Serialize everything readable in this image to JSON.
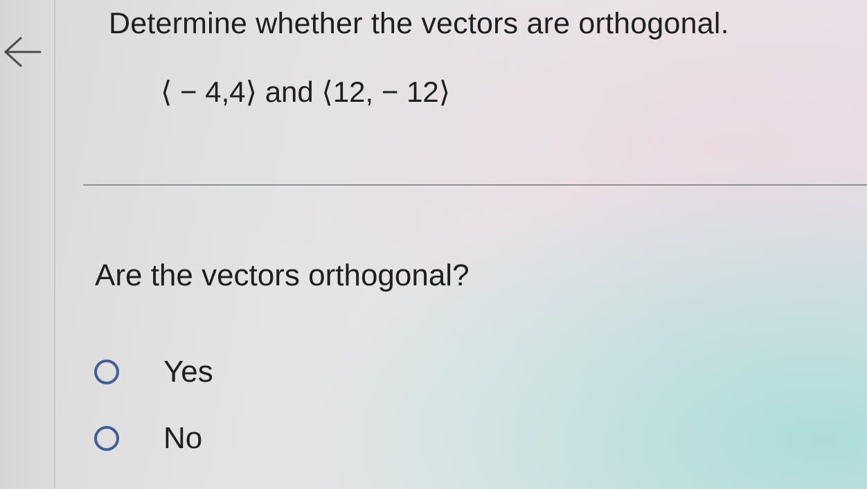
{
  "navigation": {
    "back_icon": "arrow-left-icon"
  },
  "problem": {
    "instruction": "Determine whether the vectors are orthogonal.",
    "vectors_text": "⟨ − 4,4⟩ and ⟨12, − 12⟩"
  },
  "question": {
    "prompt": "Are the vectors orthogonal?",
    "options": [
      {
        "label": "Yes",
        "selected": false
      },
      {
        "label": "No",
        "selected": false
      }
    ]
  },
  "colors": {
    "radio_border": "#3f5f95",
    "text": "#1f1f1f",
    "divider": "#8f9396"
  }
}
